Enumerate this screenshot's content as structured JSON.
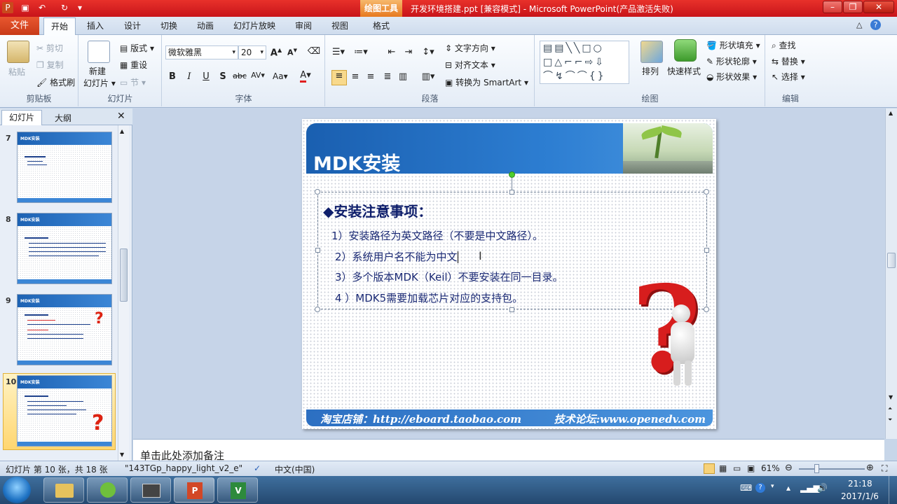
{
  "titlebar": {
    "title": "开发环境搭建.ppt [兼容模式] - Microsoft PowerPoint(产品激活失败)",
    "context_tab": "绘图工具"
  },
  "tabs": {
    "file": "文件",
    "items": [
      "开始",
      "插入",
      "设计",
      "切换",
      "动画",
      "幻灯片放映",
      "审阅",
      "视图",
      "格式"
    ]
  },
  "ribbon": {
    "clipboard": {
      "paste": "粘贴",
      "cut": "剪切",
      "copy": "复制",
      "format_painter": "格式刷",
      "label": "剪贴板"
    },
    "slides": {
      "new_slide": "新建",
      "new_slide2": "幻灯片",
      "layout": "版式",
      "reset": "重设",
      "section": "节",
      "label": "幻灯片"
    },
    "font": {
      "font_name": "微软雅黑",
      "font_size": "20",
      "label": "字体"
    },
    "paragraph": {
      "text_direction": "文字方向",
      "align_text": "对齐文本",
      "smartart": "转换为 SmartArt",
      "label": "段落"
    },
    "drawing": {
      "arrange": "排列",
      "quick_styles": "快速样式",
      "shape_fill": "形状填充",
      "shape_outline": "形状轮廓",
      "shape_effects": "形状效果",
      "label": "绘图"
    },
    "editing": {
      "find": "查找",
      "replace": "替换",
      "select": "选择",
      "label": "编辑"
    }
  },
  "left_panel": {
    "tab_slides": "幻灯片",
    "tab_outline": "大纲",
    "thumbs": [
      {
        "num": "7",
        "title": "MDK安装"
      },
      {
        "num": "8",
        "title": "MDK安装"
      },
      {
        "num": "9",
        "title": "MDK安装"
      },
      {
        "num": "10",
        "title": "MDK安装"
      }
    ]
  },
  "slide": {
    "title": "MDK安装",
    "heading": "◆安装注意事项：",
    "bullets": [
      "1）安装路径为英文路径（不要是中文路径）。",
      "2）系统用户名不能为中文",
      "3）多个版本MDK（Keil）不要安装在同一目录。",
      "4 ）MDK5需要加载芯片对应的支持包。"
    ],
    "footer_left": "淘宝店铺：http://eboard.taobao.com",
    "footer_right": "技术论坛:www.openedv.com"
  },
  "notes": {
    "placeholder": "单击此处添加备注"
  },
  "statusbar": {
    "slide_info": "幻灯片 第 10 张，共 18 张",
    "theme": "\"143TGp_happy_light_v2_e\"",
    "language": "中文(中国)",
    "zoom": "61%"
  },
  "taskbar": {
    "time": "21:18",
    "date": "2017/1/6"
  },
  "colors": {
    "titlebar": "#d41f1f",
    "slide_header": "#1a5fb0",
    "bullet_text": "#1b2a75"
  }
}
